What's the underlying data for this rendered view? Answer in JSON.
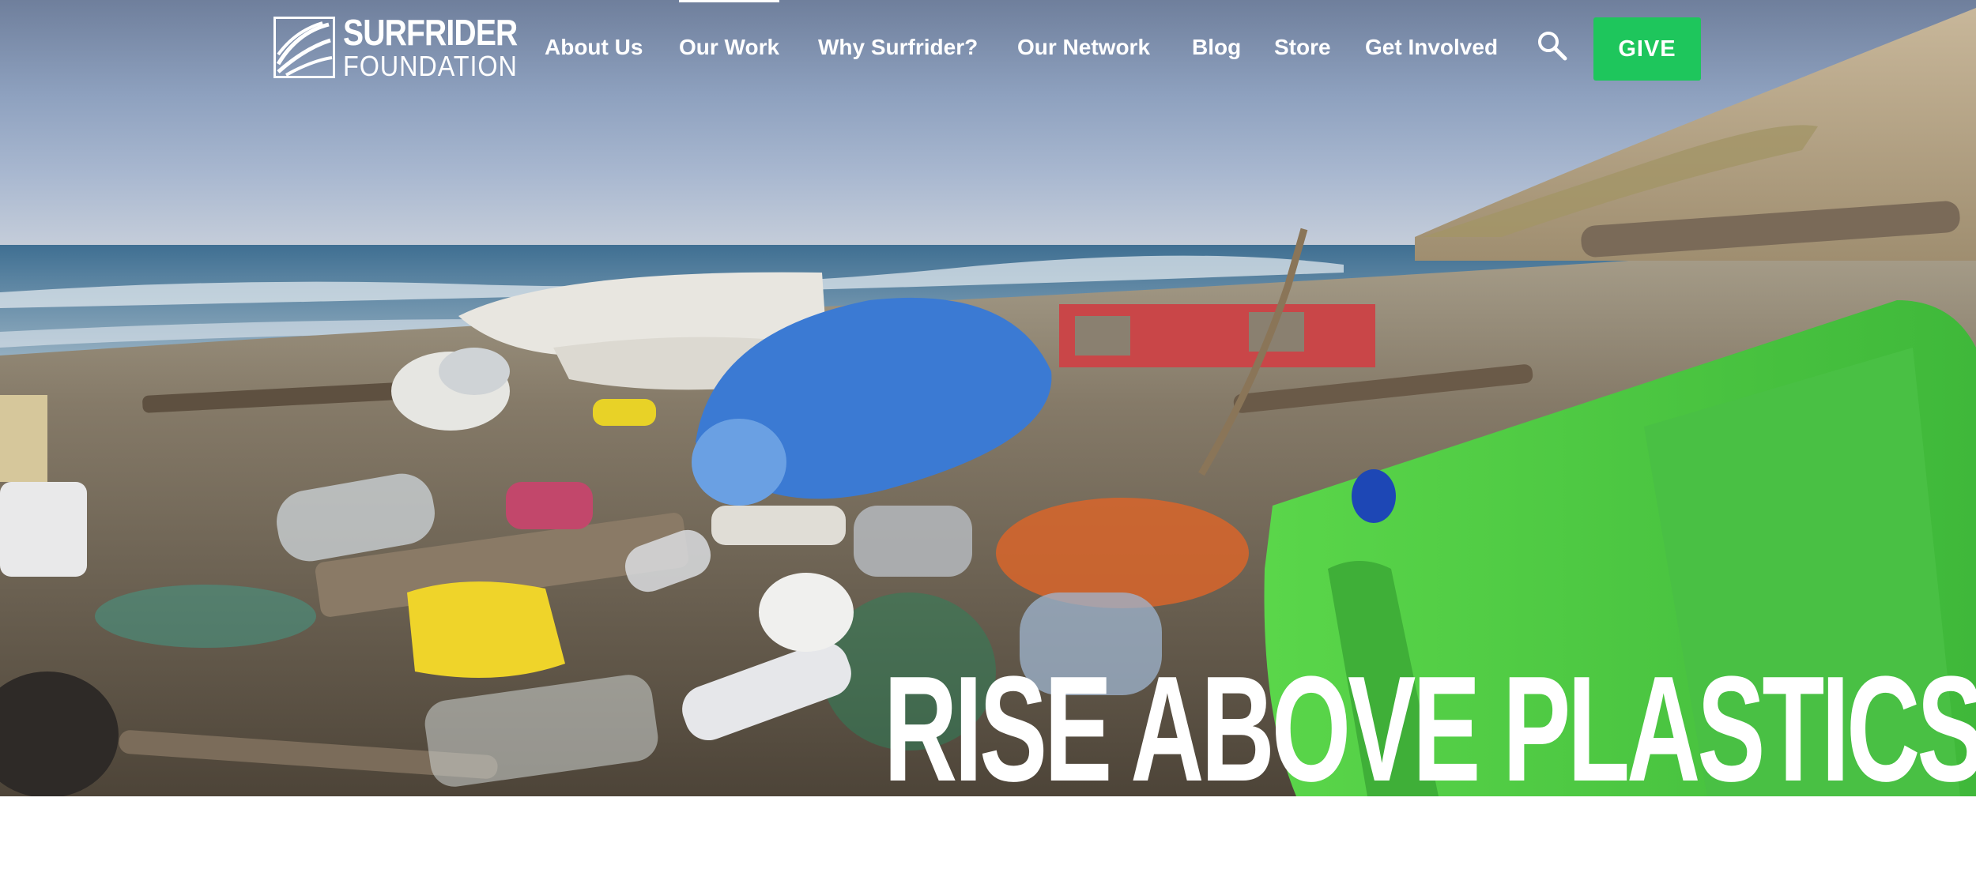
{
  "brand": {
    "line1": "SURFRIDER",
    "line2": "FOUNDATION"
  },
  "nav": {
    "items": [
      {
        "label": "About Us"
      },
      {
        "label": "Our Work",
        "active": true
      },
      {
        "label": "Why Surfrider?"
      },
      {
        "label": "Our Network"
      },
      {
        "label": "Blog"
      },
      {
        "label": "Store"
      },
      {
        "label": "Get Involved"
      }
    ],
    "search_icon": "search-icon",
    "give_label": "GIVE"
  },
  "hero": {
    "headline": "RISE ABOVE PLASTICS",
    "image": "beach-covered-in-plastic-debris"
  },
  "colors": {
    "give_button": "#1ec65c",
    "nav_text": "#ffffff",
    "headline_text": "#ffffff"
  }
}
